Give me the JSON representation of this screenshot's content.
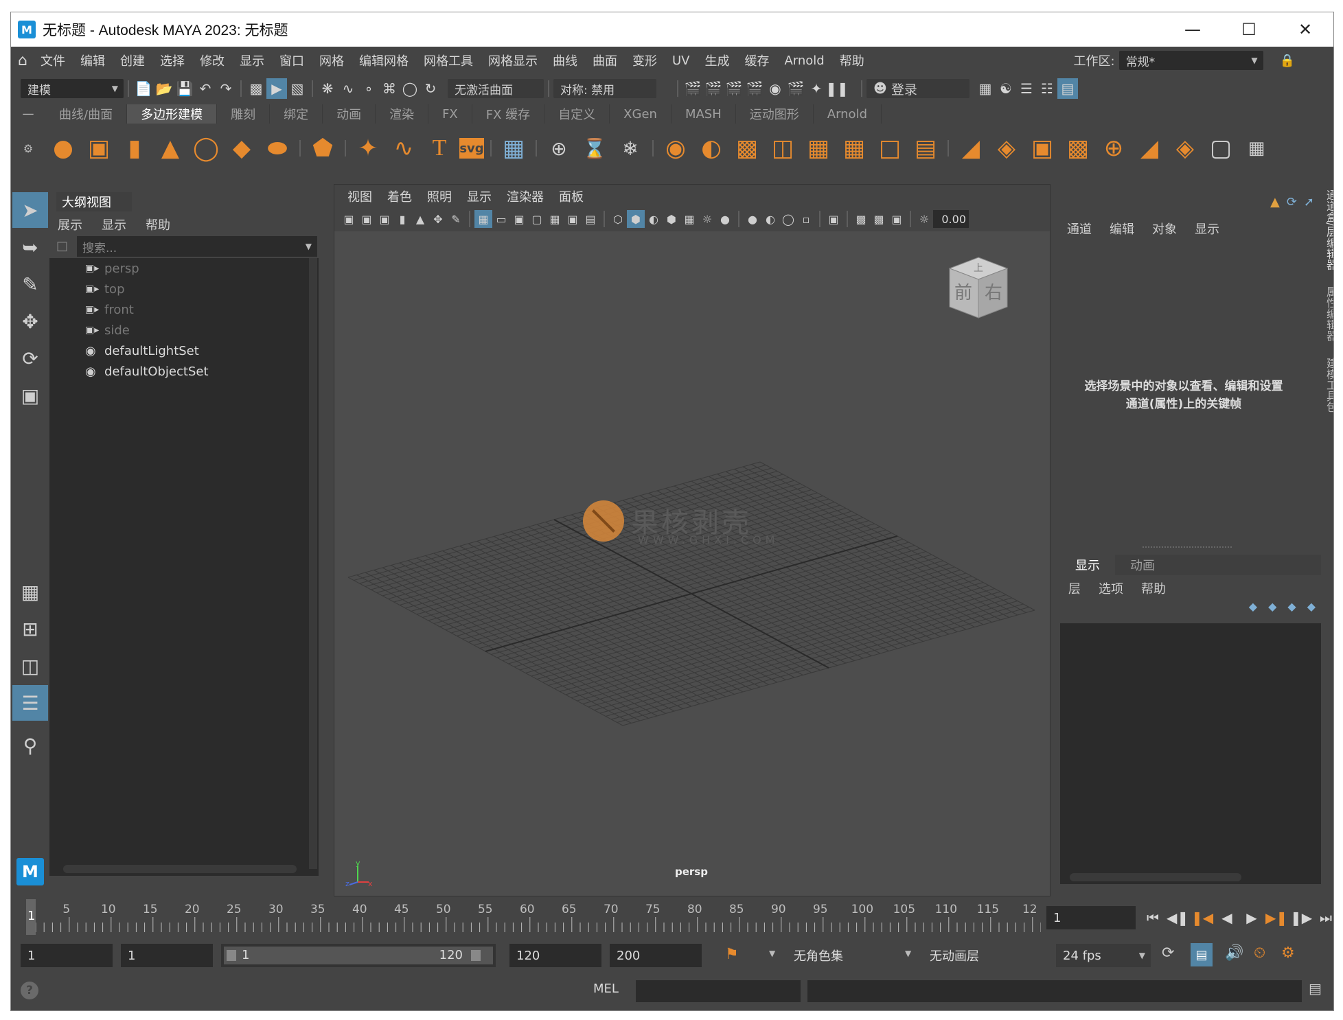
{
  "window": {
    "title": "无标题 - Autodesk MAYA 2023: 无标题",
    "app_icon_letter": "M"
  },
  "menubar": {
    "items": [
      "文件",
      "编辑",
      "创建",
      "选择",
      "修改",
      "显示",
      "窗口",
      "网格",
      "编辑网格",
      "网格工具",
      "网格显示",
      "曲线",
      "曲面",
      "变形",
      "UV",
      "生成",
      "缓存",
      "Arnold",
      "帮助"
    ],
    "workspace_label": "工作区:",
    "workspace_value": "常规*"
  },
  "statusline": {
    "mode": "建模",
    "live_surface": "无激活曲面",
    "symmetry": "对称: 禁用",
    "login": "登录"
  },
  "shelf": {
    "tabs": [
      "曲线/曲面",
      "多边形建模",
      "雕刻",
      "绑定",
      "动画",
      "渲染",
      "FX",
      "FX 缓存",
      "自定义",
      "XGen",
      "MASH",
      "运动图形",
      "Arnold"
    ],
    "active_tab": "多边形建模"
  },
  "outliner": {
    "tab": "大纲视图",
    "menu": [
      "展示",
      "显示",
      "帮助"
    ],
    "search_placeholder": "搜索...",
    "items": [
      {
        "label": "persp",
        "type": "camera"
      },
      {
        "label": "top",
        "type": "camera"
      },
      {
        "label": "front",
        "type": "camera"
      },
      {
        "label": "side",
        "type": "camera"
      },
      {
        "label": "defaultLightSet",
        "type": "set"
      },
      {
        "label": "defaultObjectSet",
        "type": "set"
      }
    ]
  },
  "viewport": {
    "menu": [
      "视图",
      "着色",
      "照明",
      "显示",
      "渲染器",
      "面板"
    ],
    "exposure_value": "0.00",
    "camera_label": "persp",
    "viewcube": {
      "top": "上",
      "front": "前",
      "right": "右"
    },
    "watermark": "果核剥壳",
    "watermark_sub": "WWW.GHXI.COM",
    "axis": {
      "y": "y",
      "z": "z",
      "x": "x"
    }
  },
  "channelbox": {
    "menu": [
      "通道",
      "编辑",
      "对象",
      "显示"
    ],
    "hint": "选择场景中的对象以查看、编辑和设置通道(属性)上的关键帧",
    "side_tabs": [
      "通道盒/层编辑器",
      "属性编辑器",
      "建模工具包"
    ],
    "layer_tabs": [
      "显示",
      "动画"
    ],
    "layer_menu": [
      "层",
      "选项",
      "帮助"
    ]
  },
  "timeslider": {
    "ticks": [
      "5",
      "10",
      "15",
      "20",
      "25",
      "30",
      "35",
      "40",
      "45",
      "50",
      "55",
      "60",
      "65",
      "70",
      "75",
      "80",
      "85",
      "90",
      "95",
      "100",
      "105",
      "110",
      "115",
      "12"
    ],
    "playhead": "1",
    "current_frame": "1"
  },
  "rangebar": {
    "start": "1",
    "playback_start": "1",
    "range_min": "1",
    "range_max": "120",
    "playback_end": "120",
    "end": "200",
    "character_set": "无角色集",
    "anim_layer": "无动画层",
    "fps": "24 fps"
  },
  "cmdline": {
    "language": "MEL"
  },
  "colors": {
    "accent": "#5285a6",
    "shelf_orange": "#e68a2e",
    "panel_bg": "#444444",
    "field_bg": "#2b2b2b",
    "viewport_bg": "#4d4d4d"
  }
}
